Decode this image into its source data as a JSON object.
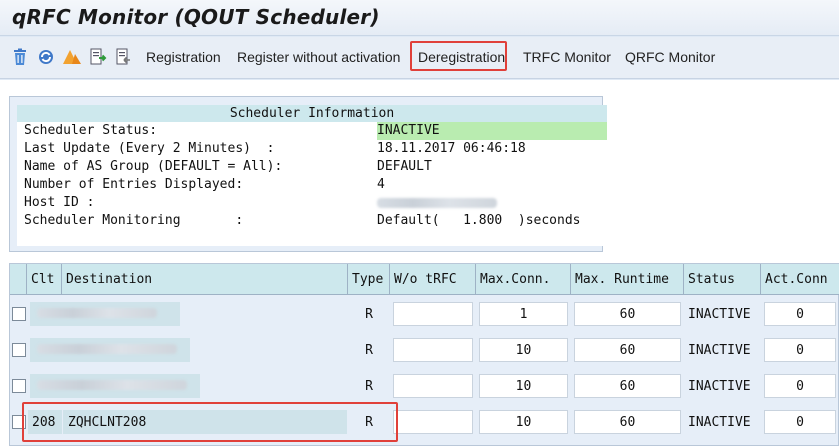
{
  "title": "qRFC Monitor (QOUT Scheduler)",
  "toolbar": {
    "icons": [
      "trash-icon",
      "refresh-icon",
      "alert-icon",
      "doc-forward-icon",
      "doc-back-icon"
    ],
    "buttons": [
      {
        "label": "Registration"
      },
      {
        "label": "Register without activation"
      },
      {
        "label": "Deregistration",
        "highlighted": true
      },
      {
        "label": "TRFC Monitor"
      },
      {
        "label": "QRFC Monitor"
      }
    ]
  },
  "scheduler_info": {
    "heading": "Scheduler Information",
    "rows": [
      {
        "label": "Scheduler Status:",
        "value": "INACTIVE"
      },
      {
        "label": "Last Update (Every 2 Minutes)  :",
        "value": "18.11.2017 06:46:18"
      },
      {
        "label": "Name of AS Group (DEFAULT = All):",
        "value": "DEFAULT"
      },
      {
        "label": "Number of Entries Displayed:",
        "value": "4"
      },
      {
        "label": "Host ID :",
        "value": ""
      },
      {
        "label": "Scheduler Monitoring       :",
        "value": "Default(   1.800  )seconds"
      }
    ]
  },
  "table": {
    "columns": [
      "Clt",
      "Destination",
      "Type",
      "W/o tRFC",
      "Max.Conn.",
      "Max. Runtime",
      "Status",
      "Act.Conn"
    ],
    "rows": [
      {
        "clt": "",
        "destination": "",
        "type": "R",
        "wo_trfc": "",
        "max_conn": "1",
        "max_runtime": "60",
        "status": "INACTIVE",
        "act_conn": "0"
      },
      {
        "clt": "",
        "destination": "",
        "type": "R",
        "wo_trfc": "",
        "max_conn": "10",
        "max_runtime": "60",
        "status": "INACTIVE",
        "act_conn": "0"
      },
      {
        "clt": "",
        "destination": "",
        "type": "R",
        "wo_trfc": "",
        "max_conn": "10",
        "max_runtime": "60",
        "status": "INACTIVE",
        "act_conn": "0"
      },
      {
        "clt": "208",
        "destination": "ZQHCLNT208",
        "type": "R",
        "wo_trfc": "",
        "max_conn": "10",
        "max_runtime": "60",
        "status": "INACTIVE",
        "act_conn": "0",
        "highlighted": true
      }
    ]
  },
  "colors": {
    "highlight": "#e0403a",
    "status_inactive_bg": "#b9ecb0",
    "header_bg": "#cde8ed"
  }
}
